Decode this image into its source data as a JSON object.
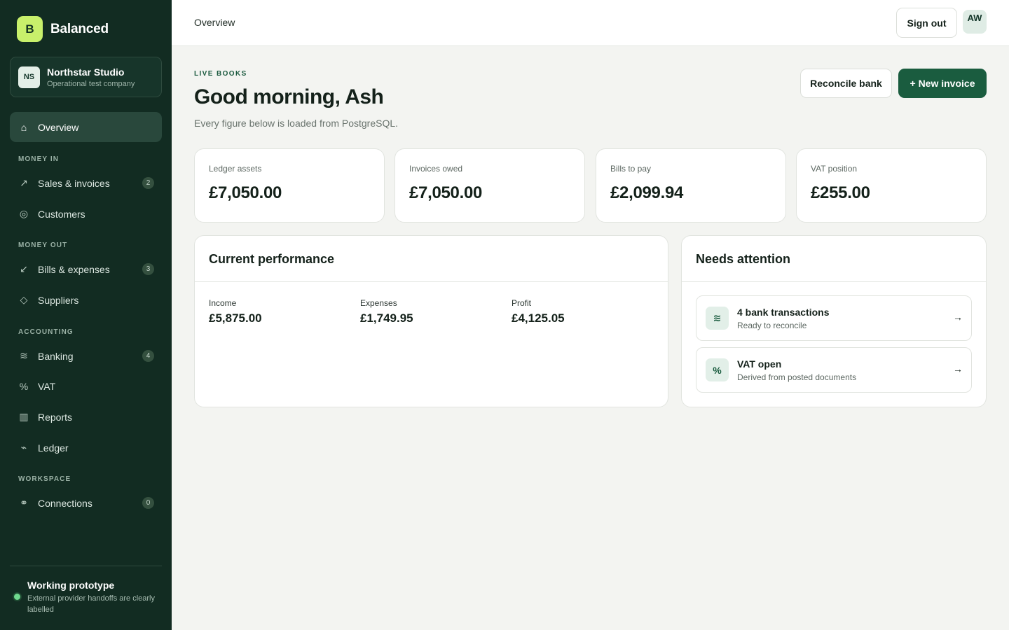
{
  "app": {
    "logo_letter": "B",
    "name": "Balanced"
  },
  "company": {
    "initials": "NS",
    "name": "Northstar Studio",
    "subtitle": "Operational test company"
  },
  "nav": {
    "overview": {
      "label": "Overview",
      "icon": "home-icon"
    },
    "section_money_in": "MONEY IN",
    "sales": {
      "label": "Sales & invoices",
      "badge": "2",
      "icon": "arrow-up-right-icon"
    },
    "customers": {
      "label": "Customers",
      "icon": "customers-icon"
    },
    "section_money_out": "MONEY OUT",
    "bills": {
      "label": "Bills & expenses",
      "badge": "3",
      "icon": "arrow-down-left-icon"
    },
    "suppliers": {
      "label": "Suppliers",
      "icon": "diamond-icon"
    },
    "section_accounting": "ACCOUNTING",
    "banking": {
      "label": "Banking",
      "badge": "4",
      "icon": "waves-icon"
    },
    "vat": {
      "label": "VAT",
      "icon": "percent-icon"
    },
    "reports": {
      "label": "Reports",
      "icon": "columns-icon"
    },
    "ledger": {
      "label": "Ledger",
      "icon": "ledger-icon"
    },
    "section_workspace": "WORKSPACE",
    "connections": {
      "label": "Connections",
      "badge": "0",
      "icon": "link-icon"
    }
  },
  "prototype": {
    "title": "Working prototype",
    "subtitle": "External provider handoffs are clearly labelled",
    "status_color": "#6fd88e"
  },
  "topbar": {
    "title": "Overview",
    "sign_out": "Sign out",
    "user_initials": "AW"
  },
  "header": {
    "eyebrow": "LIVE BOOKS",
    "greeting": "Good morning, Ash",
    "subtitle": "Every figure below is loaded from PostgreSQL.",
    "reconcile_label": "Reconcile bank",
    "new_invoice_label": "+ New invoice"
  },
  "stats": [
    {
      "label": "Ledger assets",
      "value": "£7,050.00"
    },
    {
      "label": "Invoices owed",
      "value": "£7,050.00"
    },
    {
      "label": "Bills to pay",
      "value": "£2,099.94"
    },
    {
      "label": "VAT position",
      "value": "£255.00"
    }
  ],
  "performance": {
    "title": "Current performance",
    "metrics": [
      {
        "label": "Income",
        "value": "£5,875.00"
      },
      {
        "label": "Expenses",
        "value": "£1,749.95"
      },
      {
        "label": "Profit",
        "value": "£4,125.05"
      }
    ]
  },
  "attention": {
    "title": "Needs attention",
    "items": [
      {
        "icon_glyph": "≋",
        "icon": "bank-waves-icon",
        "title": "4 bank transactions",
        "subtitle": "Ready to reconcile",
        "arrow": "→"
      },
      {
        "icon_glyph": "%",
        "icon": "percent-icon",
        "title": "VAT open",
        "subtitle": "Derived from posted documents",
        "arrow": "→"
      }
    ]
  },
  "colors": {
    "sidebar": "#122c22",
    "accent": "#1a5c3f",
    "logo": "#c8f06b"
  }
}
